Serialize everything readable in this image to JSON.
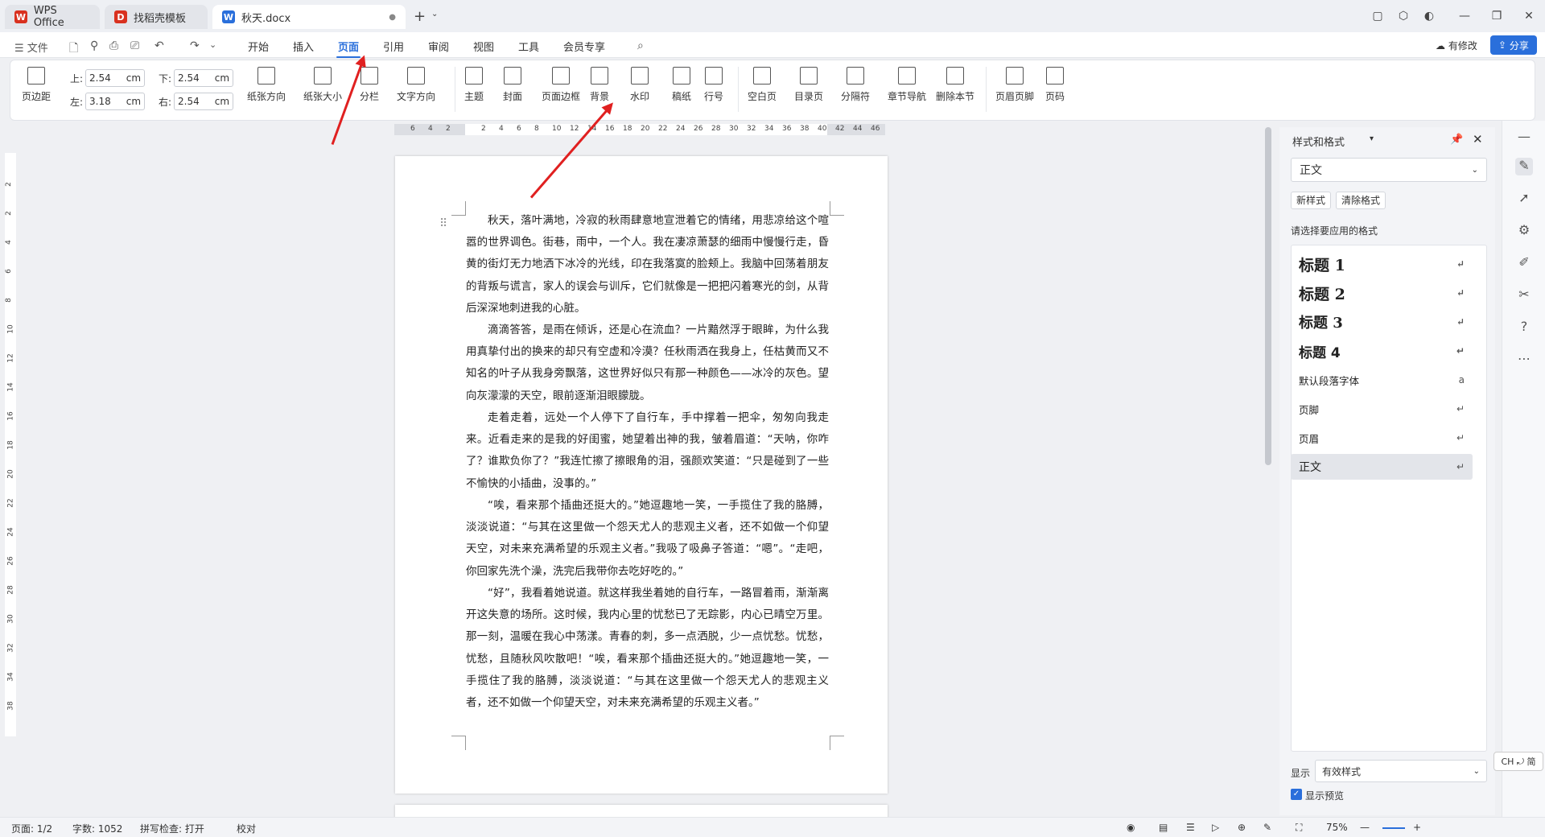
{
  "tabs": [
    {
      "label": "WPS Office",
      "logo": "W",
      "logo_color": "#d9311f"
    },
    {
      "label": "找稻壳模板",
      "logo": "D",
      "logo_color": "#d9311f"
    },
    {
      "label": "秋天.docx",
      "logo": "W",
      "logo_color": "#2a6fdb"
    }
  ],
  "menu": {
    "file": "文件",
    "items": [
      "开始",
      "插入",
      "页面",
      "引用",
      "审阅",
      "视图",
      "工具",
      "会员专享"
    ],
    "active": "页面",
    "edited": "有修改",
    "share": "分享"
  },
  "ribbon": {
    "margin": "页边距",
    "top_label": "上:",
    "top_value": "2.54",
    "bottom_label": "下:",
    "bottom_value": "2.54",
    "left_label": "左:",
    "left_value": "3.18",
    "right_label": "右:",
    "right_value": "2.54",
    "unit": "cm",
    "orientation": "纸张方向",
    "size": "纸张大小",
    "columns": "分栏",
    "text_direction": "文字方向",
    "theme": "主题",
    "cover": "封面",
    "page_border": "页面边框",
    "background": "背景",
    "watermark": "水印",
    "draft": "稿纸",
    "line_number": "行号",
    "blank_page": "空白页",
    "toc_page": "目录页",
    "breaks": "分隔符",
    "section_nav": "章节导航",
    "delete_section": "删除本节",
    "header_footer": "页眉页脚",
    "page_number": "页码"
  },
  "ruler": {
    "h_ticks": [
      "6",
      "4",
      "2",
      "",
      "2",
      "4",
      "6",
      "8",
      "10",
      "12",
      "14",
      "16",
      "18",
      "20",
      "22",
      "24",
      "26",
      "28",
      "30",
      "32",
      "34",
      "36",
      "38",
      "40",
      "42",
      "44",
      "46"
    ],
    "v_ticks": [
      "2",
      "2",
      "4",
      "6",
      "8",
      "10",
      "12",
      "14",
      "16",
      "18",
      "20",
      "22",
      "24",
      "26",
      "28",
      "30",
      "32",
      "34",
      "38"
    ]
  },
  "document": {
    "paragraphs": [
      "秋天，落叶满地，冷寂的秋雨肆意地宣泄着它的情绪，用悲凉给这个喧嚣的世界调色。街巷，雨中，一个人。我在凄凉萧瑟的细雨中慢慢行走，昏黄的街灯无力地洒下冰冷的光线，印在我落寞的脸颊上。我脑中回荡着朋友的背叛与谎言，家人的误会与训斥，它们就像是一把把闪着寒光的剑，从背后深深地刺进我的心脏。",
      "滴滴答答，是雨在倾诉，还是心在流血？一片黯然浮于眼眸，为什么我用真挚付出的换来的却只有空虚和冷漠？任秋雨洒在我身上，任枯黄而又不知名的叶子从我身旁飘落，这世界好似只有那一种颜色——冰冷的灰色。望向灰濛濛的天空，眼前逐渐泪眼朦胧。",
      "走着走着，远处一个人停下了自行车，手中撑着一把伞，匆匆向我走来。近看走来的是我的好闺蜜，她望着出神的我，皱着眉道：“天呐，你咋了？谁欺负你了？”我连忙擦了擦眼角的泪，强颜欢笑道：“只是碰到了一些不愉快的小插曲，没事的。”",
      "“唉，看来那个插曲还挺大的。”她逗趣地一笑，一手揽住了我的胳膊，淡淡说道：“与其在这里做一个怨天尤人的悲观主义者，还不如做一个仰望天空，对未来充满希望的乐观主义者。”我吸了吸鼻子答道：“嗯”。“走吧，你回家先洗个澡，洗完后我带你去吃好吃的。”",
      "“好”，我看着她说道。就这样我坐着她的自行车，一路冒着雨，渐渐离开这失意的场所。这时候，我内心里的忧愁已了无踪影，内心已晴空万里。那一刻，温暖在我心中荡漾。青春的刺，多一点洒脱，少一点忧愁。忧愁，忧愁，且随秋风吹散吧！“唉，看来那个插曲还挺大的。”她逗趣地一笑，一手揽住了我的胳膊，淡淡说道：“与其在这里做一个怨天尤人的悲观主义者，还不如做一个仰望天空，对未来充满希望的乐观主义者。”"
    ]
  },
  "panel": {
    "title": "样式和格式",
    "current_style": "正文",
    "new_style": "新样式",
    "clear_format": "清除格式",
    "prompt": "请选择要应用的格式",
    "styles": [
      "标题 1",
      "标题 2",
      "标题 3",
      "标题 4",
      "默认段落字体",
      "页脚",
      "页眉",
      "正文"
    ],
    "show_label": "显示",
    "show_value": "有效样式",
    "preview_label": "显示预览",
    "ime": "CH ⤾ 简"
  },
  "status": {
    "page": "页面: 1/2",
    "words": "字数: 1052",
    "spell": "拼写检查: 打开",
    "proof": "校对",
    "zoom": "75%"
  },
  "colors": {
    "accent": "#2a6fdb",
    "arrow": "#e02020"
  }
}
